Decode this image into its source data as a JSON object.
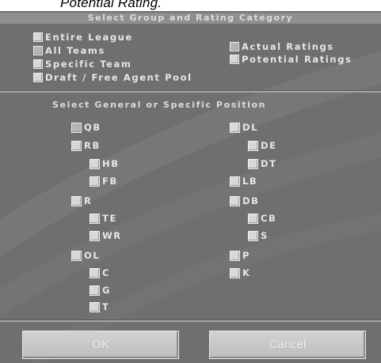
{
  "caption": "Potential Rating.",
  "group_header": "Select Group and Rating Category",
  "groups": [
    {
      "label": "Entire League",
      "checked": false
    },
    {
      "label": "All Teams",
      "checked": true
    },
    {
      "label": "Specific Team",
      "checked": false
    },
    {
      "label": "Draft / Free Agent Pool",
      "checked": false
    }
  ],
  "ratings": [
    {
      "label": "Actual Ratings",
      "checked": true
    },
    {
      "label": "Potential Ratings",
      "checked": false
    }
  ],
  "position_header": "Select General or Specific Position",
  "positions_left": [
    {
      "label": "QB",
      "checked": true
    },
    {
      "label": "RB",
      "checked": false
    },
    {
      "label": "HB",
      "checked": false
    },
    {
      "label": "FB",
      "checked": false
    },
    {
      "label": "R",
      "checked": false
    },
    {
      "label": "TE",
      "checked": false
    },
    {
      "label": "WR",
      "checked": false
    },
    {
      "label": "OL",
      "checked": false
    },
    {
      "label": "C",
      "checked": false
    },
    {
      "label": "G",
      "checked": false
    },
    {
      "label": "T",
      "checked": false
    }
  ],
  "positions_right": [
    {
      "label": "DL",
      "checked": false
    },
    {
      "label": "DE",
      "checked": false
    },
    {
      "label": "DT",
      "checked": false
    },
    {
      "label": "LB",
      "checked": false
    },
    {
      "label": "DB",
      "checked": false
    },
    {
      "label": "CB",
      "checked": false
    },
    {
      "label": "S",
      "checked": false
    },
    {
      "label": "P",
      "checked": false
    },
    {
      "label": "K",
      "checked": false
    }
  ],
  "buttons": {
    "ok": "OK",
    "cancel": "Cancel"
  },
  "colors": {
    "panel": "#6f6f6f",
    "header_bar": "#8f8f8f",
    "text": "#e6e6e6"
  }
}
